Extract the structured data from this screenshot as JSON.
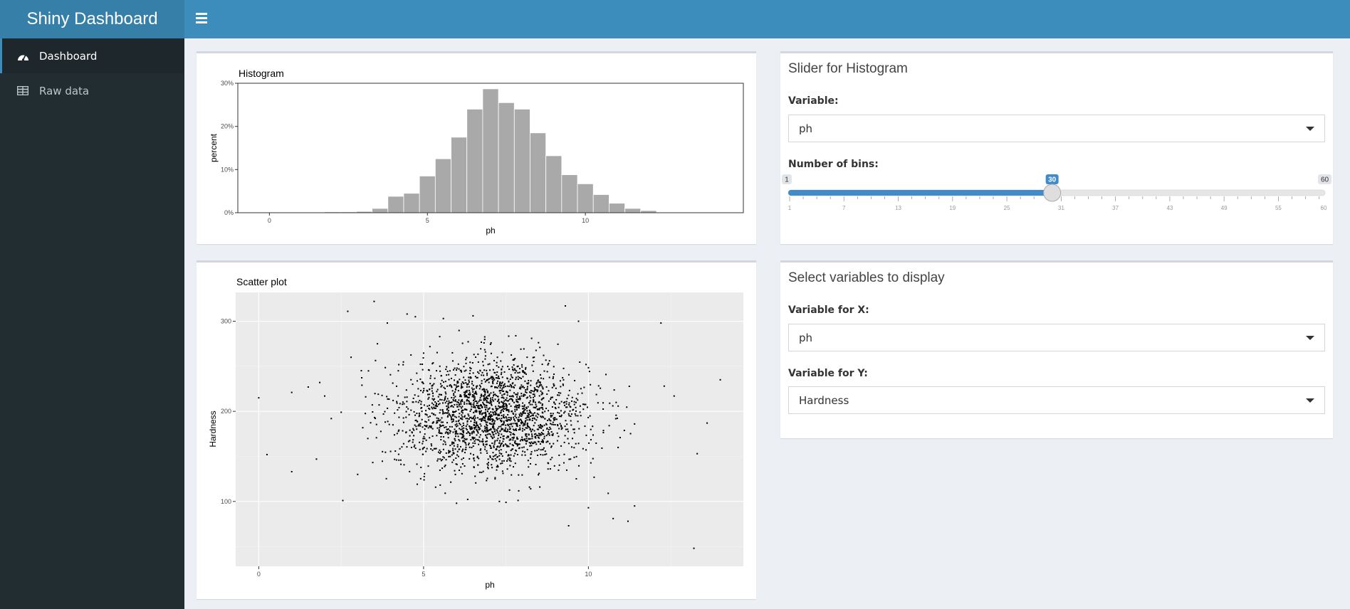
{
  "header": {
    "title": "Shiny Dashboard"
  },
  "sidebar": {
    "items": [
      {
        "label": "Dashboard",
        "icon": "tachometer-icon",
        "active": true
      },
      {
        "label": "Raw data",
        "icon": "table-icon",
        "active": false
      }
    ]
  },
  "slider_box": {
    "title": "Slider for Histogram",
    "variable_label": "Variable:",
    "variable_value": "ph",
    "bins_label": "Number of bins:",
    "slider": {
      "min": 1,
      "max": 60,
      "value": 30,
      "min_label": "1",
      "max_label": "60",
      "value_label": "30",
      "ticks": [
        "1",
        "7",
        "13",
        "19",
        "25",
        "31",
        "37",
        "43",
        "49",
        "55",
        "60"
      ],
      "accent": "#428bca"
    }
  },
  "select_box": {
    "title": "Select variables to display",
    "x_label": "Variable for X:",
    "x_value": "ph",
    "y_label": "Variable for Y:",
    "y_value": "Hardness"
  },
  "chart_data": [
    {
      "type": "bar",
      "title": "Histogram",
      "xlabel": "ph",
      "ylabel": "percent",
      "xlim": [
        -1,
        15
      ],
      "ylim": [
        0,
        0.3
      ],
      "x_ticks": [
        0,
        5,
        10
      ],
      "y_ticks": [
        "0%",
        "10%",
        "20%",
        "30%"
      ],
      "bar_color": "#a9a9a9",
      "bin_width": 0.5,
      "bin_starts": [
        1.75,
        2.25,
        2.75,
        3.25,
        3.75,
        4.25,
        4.75,
        5.25,
        5.75,
        6.25,
        6.75,
        7.25,
        7.75,
        8.25,
        8.75,
        9.25,
        9.75,
        10.25,
        10.75,
        11.25,
        11.75
      ],
      "values": [
        0.002,
        0.002,
        0.003,
        0.01,
        0.038,
        0.045,
        0.085,
        0.125,
        0.175,
        0.24,
        0.287,
        0.255,
        0.24,
        0.185,
        0.132,
        0.088,
        0.067,
        0.042,
        0.022,
        0.01,
        0.005
      ]
    },
    {
      "type": "scatter",
      "title": "Scatter plot",
      "xlabel": "ph",
      "ylabel": "Hardness",
      "xlim": [
        -0.7,
        14.7
      ],
      "ylim": [
        28,
        332
      ],
      "x_ticks": [
        0,
        5,
        10
      ],
      "y_ticks": [
        100,
        200,
        300
      ],
      "point_color": "#000000",
      "panel_color": "#ebebeb",
      "outliers": [
        [
          0.0,
          215
        ],
        [
          0.25,
          152
        ],
        [
          1.0,
          133
        ],
        [
          1.0,
          221
        ],
        [
          1.5,
          227
        ],
        [
          1.75,
          147
        ],
        [
          1.85,
          232
        ],
        [
          2.0,
          217
        ],
        [
          2.2,
          192
        ],
        [
          2.5,
          199
        ],
        [
          2.55,
          101
        ],
        [
          2.7,
          311
        ],
        [
          2.8,
          260
        ],
        [
          3.0,
          130
        ],
        [
          3.5,
          322
        ],
        [
          3.6,
          275
        ],
        [
          3.9,
          298
        ],
        [
          4.5,
          308
        ],
        [
          4.75,
          305
        ],
        [
          5.6,
          303
        ],
        [
          6.0,
          98
        ],
        [
          6.5,
          306
        ],
        [
          7.3,
          100
        ],
        [
          7.5,
          99
        ],
        [
          9.3,
          317
        ],
        [
          9.4,
          73
        ],
        [
          9.7,
          300
        ],
        [
          10.0,
          93
        ],
        [
          10.6,
          109
        ],
        [
          10.75,
          81
        ],
        [
          11.2,
          78
        ],
        [
          11.4,
          95
        ],
        [
          11.4,
          186
        ],
        [
          12.2,
          298
        ],
        [
          12.3,
          228
        ],
        [
          12.6,
          217
        ],
        [
          13.2,
          48
        ],
        [
          13.3,
          153
        ],
        [
          13.6,
          187
        ],
        [
          14.0,
          235
        ]
      ]
    }
  ]
}
